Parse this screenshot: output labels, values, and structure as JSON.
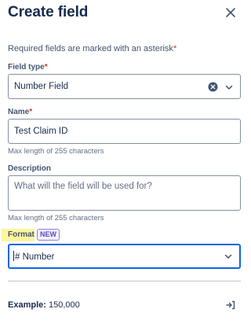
{
  "header": {
    "title": "Create field"
  },
  "form": {
    "required_hint": "Required fields are marked with an asterisk",
    "asterisk": "*",
    "field_type": {
      "label": "Field type",
      "value": "Number Field"
    },
    "name": {
      "label": "Name",
      "value": "Test Claim ID",
      "helper": "Max length of 255 characters"
    },
    "description": {
      "label": "Description",
      "placeholder": "What will the field will be used for?",
      "helper": "Max length of 255 characters"
    },
    "format": {
      "label": "Format",
      "badge": "NEW",
      "value": "# Number",
      "highlight_color": "#fff59d"
    }
  },
  "example": {
    "label": "Example:",
    "value": "150,000"
  },
  "colors": {
    "focus_border": "#0c66e4",
    "required": "#c9372c",
    "badge_border": "#8f7ee7"
  }
}
